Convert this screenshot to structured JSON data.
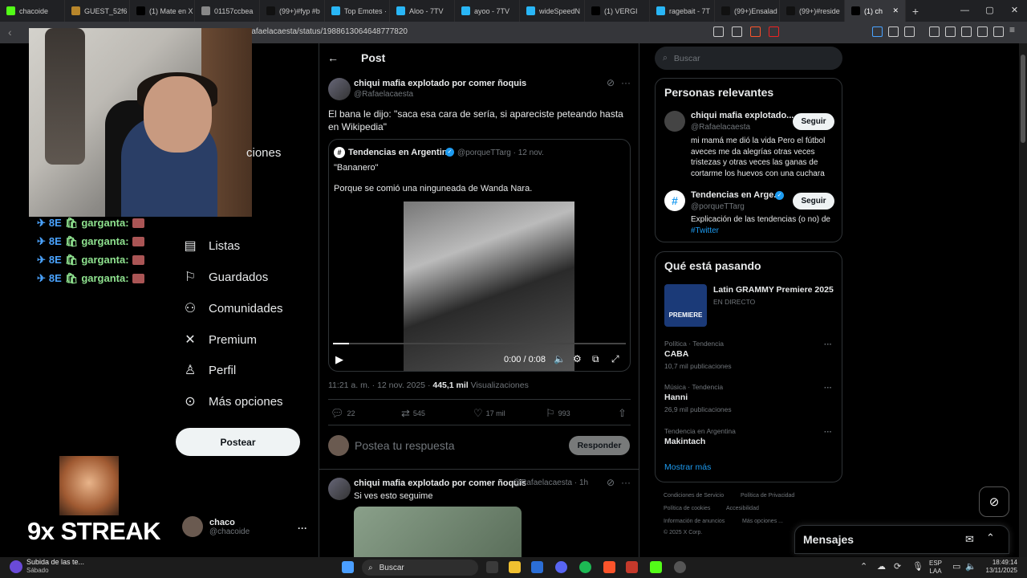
{
  "browser": {
    "tabs": [
      {
        "label": "chacoide",
        "color": "#53fc18",
        "icon": "kick-icon"
      },
      {
        "label": "GUEST_52f6",
        "color": "#b8862b",
        "icon": "guest-icon"
      },
      {
        "label": "(1) Mate en X",
        "color": "#000000",
        "icon": "x-icon"
      },
      {
        "label": "01157ccbea",
        "color": "#888888",
        "icon": "globe-icon"
      },
      {
        "label": "(99+)#fyp #b",
        "color": "#111111",
        "icon": "tiktok-icon"
      },
      {
        "label": "Top Emotes ·",
        "color": "#29b6f6",
        "icon": "7tv-icon"
      },
      {
        "label": "Aloo - 7TV",
        "color": "#29b6f6",
        "icon": "7tv-icon"
      },
      {
        "label": "ayoo - 7TV",
        "color": "#29b6f6",
        "icon": "7tv-icon"
      },
      {
        "label": "wideSpeedN",
        "color": "#29b6f6",
        "icon": "7tv-icon"
      },
      {
        "label": "(1) VERGI",
        "color": "#000000",
        "icon": "x-icon"
      },
      {
        "label": "ragebait - 7T",
        "color": "#29b6f6",
        "icon": "7tv-icon"
      },
      {
        "label": "(99+)Ensalad",
        "color": "#111111",
        "icon": "tiktok-icon"
      },
      {
        "label": "(99+)#reside",
        "color": "#111111",
        "icon": "tiktok-icon"
      },
      {
        "label": "(1) ch",
        "color": "#000000",
        "icon": "x-icon"
      }
    ],
    "url": "rafaelacaesta/status/1988613064648777820"
  },
  "stream": {
    "chat_lines": [
      "garganta:",
      "garganta:",
      "garganta:",
      "garganta:"
    ],
    "streak": "9x STREAK"
  },
  "sidebar": {
    "partial_item": "ciones",
    "items": [
      {
        "label": "Listas",
        "icon": "list-icon"
      },
      {
        "label": "Guardados",
        "icon": "bookmark-icon"
      },
      {
        "label": "Comunidades",
        "icon": "communities-icon"
      },
      {
        "label": "Premium",
        "icon": "x-premium-icon"
      },
      {
        "label": "Perfil",
        "icon": "person-icon"
      },
      {
        "label": "Más opciones",
        "icon": "more-icon"
      }
    ],
    "post_button": "Postear",
    "profile": {
      "name": "chaco",
      "handle": "@chacoide"
    }
  },
  "post": {
    "header": "Post",
    "author": "chiqui mafia explotado por comer ñoquis",
    "handle": "@Rafaelacaesta",
    "text": "El bana le dijo: \"saca esa cara de sería, si apareciste peteando hasta en Wikipedia\"",
    "quote": {
      "author": "Tendencias en Argentina",
      "handle": "@porqueTTarg · 12 nov.",
      "line1": "\"Bananero\"",
      "line2": "Porque se comió una ninguneada de Wanda Nara.",
      "video_time": "0:00 / 0:08"
    },
    "timestamp": "11:21 a. m. · 12 nov. 2025 · ",
    "views": "445,1 mil",
    "views_label": " Visualizaciones",
    "stats": {
      "replies": "22",
      "reposts": "545",
      "likes": "17 mil",
      "bookmarks": "993"
    },
    "reply_placeholder": "Postea tu respuesta",
    "reply_button": "Responder"
  },
  "reply_post": {
    "author": "chiqui mafia explotado por comer ñoquis",
    "handle": "@Rafaelacaesta · 1h",
    "text": "Si ves esto seguime"
  },
  "right": {
    "search_placeholder": "Buscar",
    "relevant_title": "Personas relevantes",
    "people": [
      {
        "name": "chiqui mafia explotado...",
        "handle": "@Rafaelacaesta",
        "bio": "mi mamá me dió la vida Pero el fútbol aveces me da alegrías otras veces tristezas y otras veces las ganas de cortarme los huevos con una cuchara",
        "follow": "Seguir"
      },
      {
        "name": "Tendencias en Arge...",
        "handle": "@porqueTTarg",
        "bio": "Explicación de las tendencias (o no) de ",
        "bio_link": "#Twitter",
        "follow": "Seguir"
      }
    ],
    "happening_title": "Qué está pasando",
    "event": {
      "title": "Latin GRAMMY Premiere 2025",
      "status": "EN DIRECTO",
      "badge": "PREMIERE"
    },
    "trends": [
      {
        "category": "Política · Tendencia",
        "name": "CABA",
        "count": "10,7 mil publicaciones"
      },
      {
        "category": "Música · Tendencia",
        "name": "Hanni",
        "count": "26,9 mil publicaciones"
      },
      {
        "category": "Tendencia en Argentina",
        "name": "Makintach",
        "count": ""
      }
    ],
    "show_more": "Mostrar más",
    "footer": [
      "Condiciones de Servicio",
      "Política de Privacidad",
      "Política de cookies",
      "Accesibilidad",
      "Información de anuncios",
      "Más opciones ...",
      "© 2025 X Corp."
    ]
  },
  "messages": {
    "title": "Mensajes"
  },
  "taskbar": {
    "notif_title": "Subida de las te...",
    "notif_sub": "Sábado",
    "search": "Buscar",
    "lang": "ESP",
    "lang2": "LAA",
    "time": "18:49:14",
    "date": "13/11/2025"
  },
  "colors": {
    "accent": "#1d9bf0",
    "verified": "#1d9bf0",
    "chat_name": "#8fe28f"
  }
}
